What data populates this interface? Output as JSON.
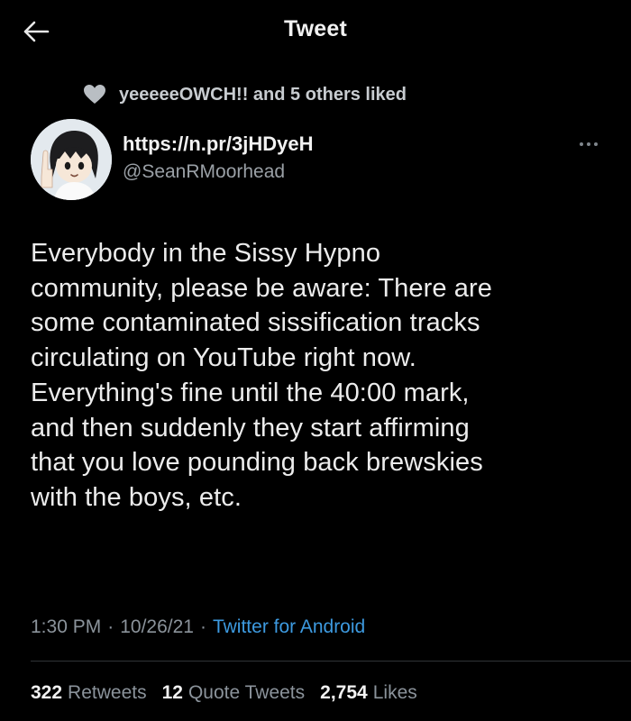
{
  "header": {
    "title": "Tweet",
    "back_icon": "arrow-left-icon"
  },
  "social_context": {
    "icon": "heart-icon",
    "text": "yeeeeeOWCH!! and 5 others liked"
  },
  "author": {
    "display_name": "https://n.pr/3jHDyeH",
    "handle": "@SeanRMoorhead"
  },
  "more_icon": "more-horizontal-icon",
  "tweet": {
    "lines": [
      "Everybody in the Sissy Hypno",
      "community, please be aware: There are",
      "some contaminated sissification tracks",
      "circulating on YouTube right now.",
      "Everything's fine until the 40:00 mark,",
      "and then suddenly they start affirming",
      "that you love pounding back brewskies",
      "with the boys, etc."
    ]
  },
  "meta": {
    "time": "1:30 PM",
    "separator": "·",
    "date": "10/26/21",
    "source": "Twitter for Android"
  },
  "stats": {
    "retweets_count": "322",
    "retweets_label": "Retweets",
    "quotes_count": "12",
    "quotes_label": "Quote Tweets",
    "likes_count": "2,754",
    "likes_label": "Likes"
  },
  "colors": {
    "background": "#000000",
    "text": "#e7e9ea",
    "secondary": "#8b939b",
    "link": "#3d9ae0"
  }
}
